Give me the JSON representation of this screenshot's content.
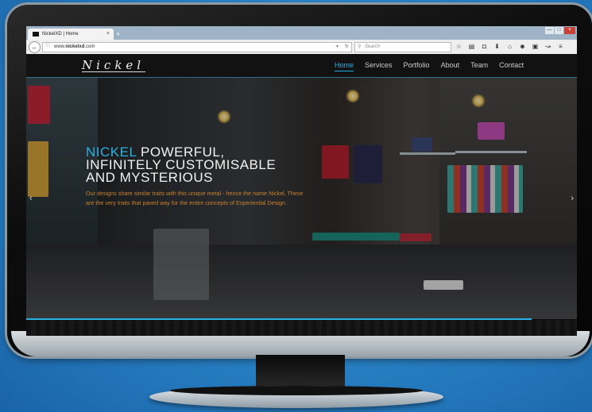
{
  "browser": {
    "tab_title": "NickelXD | Home",
    "tab_close": "×",
    "new_tab": "+",
    "window_buttons": [
      "—",
      "□",
      "×"
    ],
    "url_prefix": "www.",
    "url_domain": "nickelxd",
    "url_suffix": ".com",
    "search_placeholder": "Search",
    "toolbar_icons": [
      "star-icon",
      "bookmarks-icon",
      "pocket-icon",
      "download-icon",
      "home-icon",
      "chat-icon",
      "extension-icon",
      "share-icon",
      "menu-icon"
    ]
  },
  "site": {
    "logo": "Nickel",
    "menu": [
      "Home",
      "Services",
      "Portfolio",
      "About",
      "Team",
      "Contact"
    ],
    "active_menu": "Home",
    "hero": {
      "accent_word": "NICKEL",
      "headline_rest": " POWERFUL,",
      "headline_line2": "INFINITELY CUSTOMISABLE",
      "headline_line3": "AND MYSTERIOUS",
      "description": "Our designs share similar traits with this unique metal - hence the name Nickel. These are the very traits that paved way for the entire concepts of Experiential Design."
    },
    "colors": {
      "accent": "#2ab1e3",
      "description": "#c9822e"
    }
  }
}
